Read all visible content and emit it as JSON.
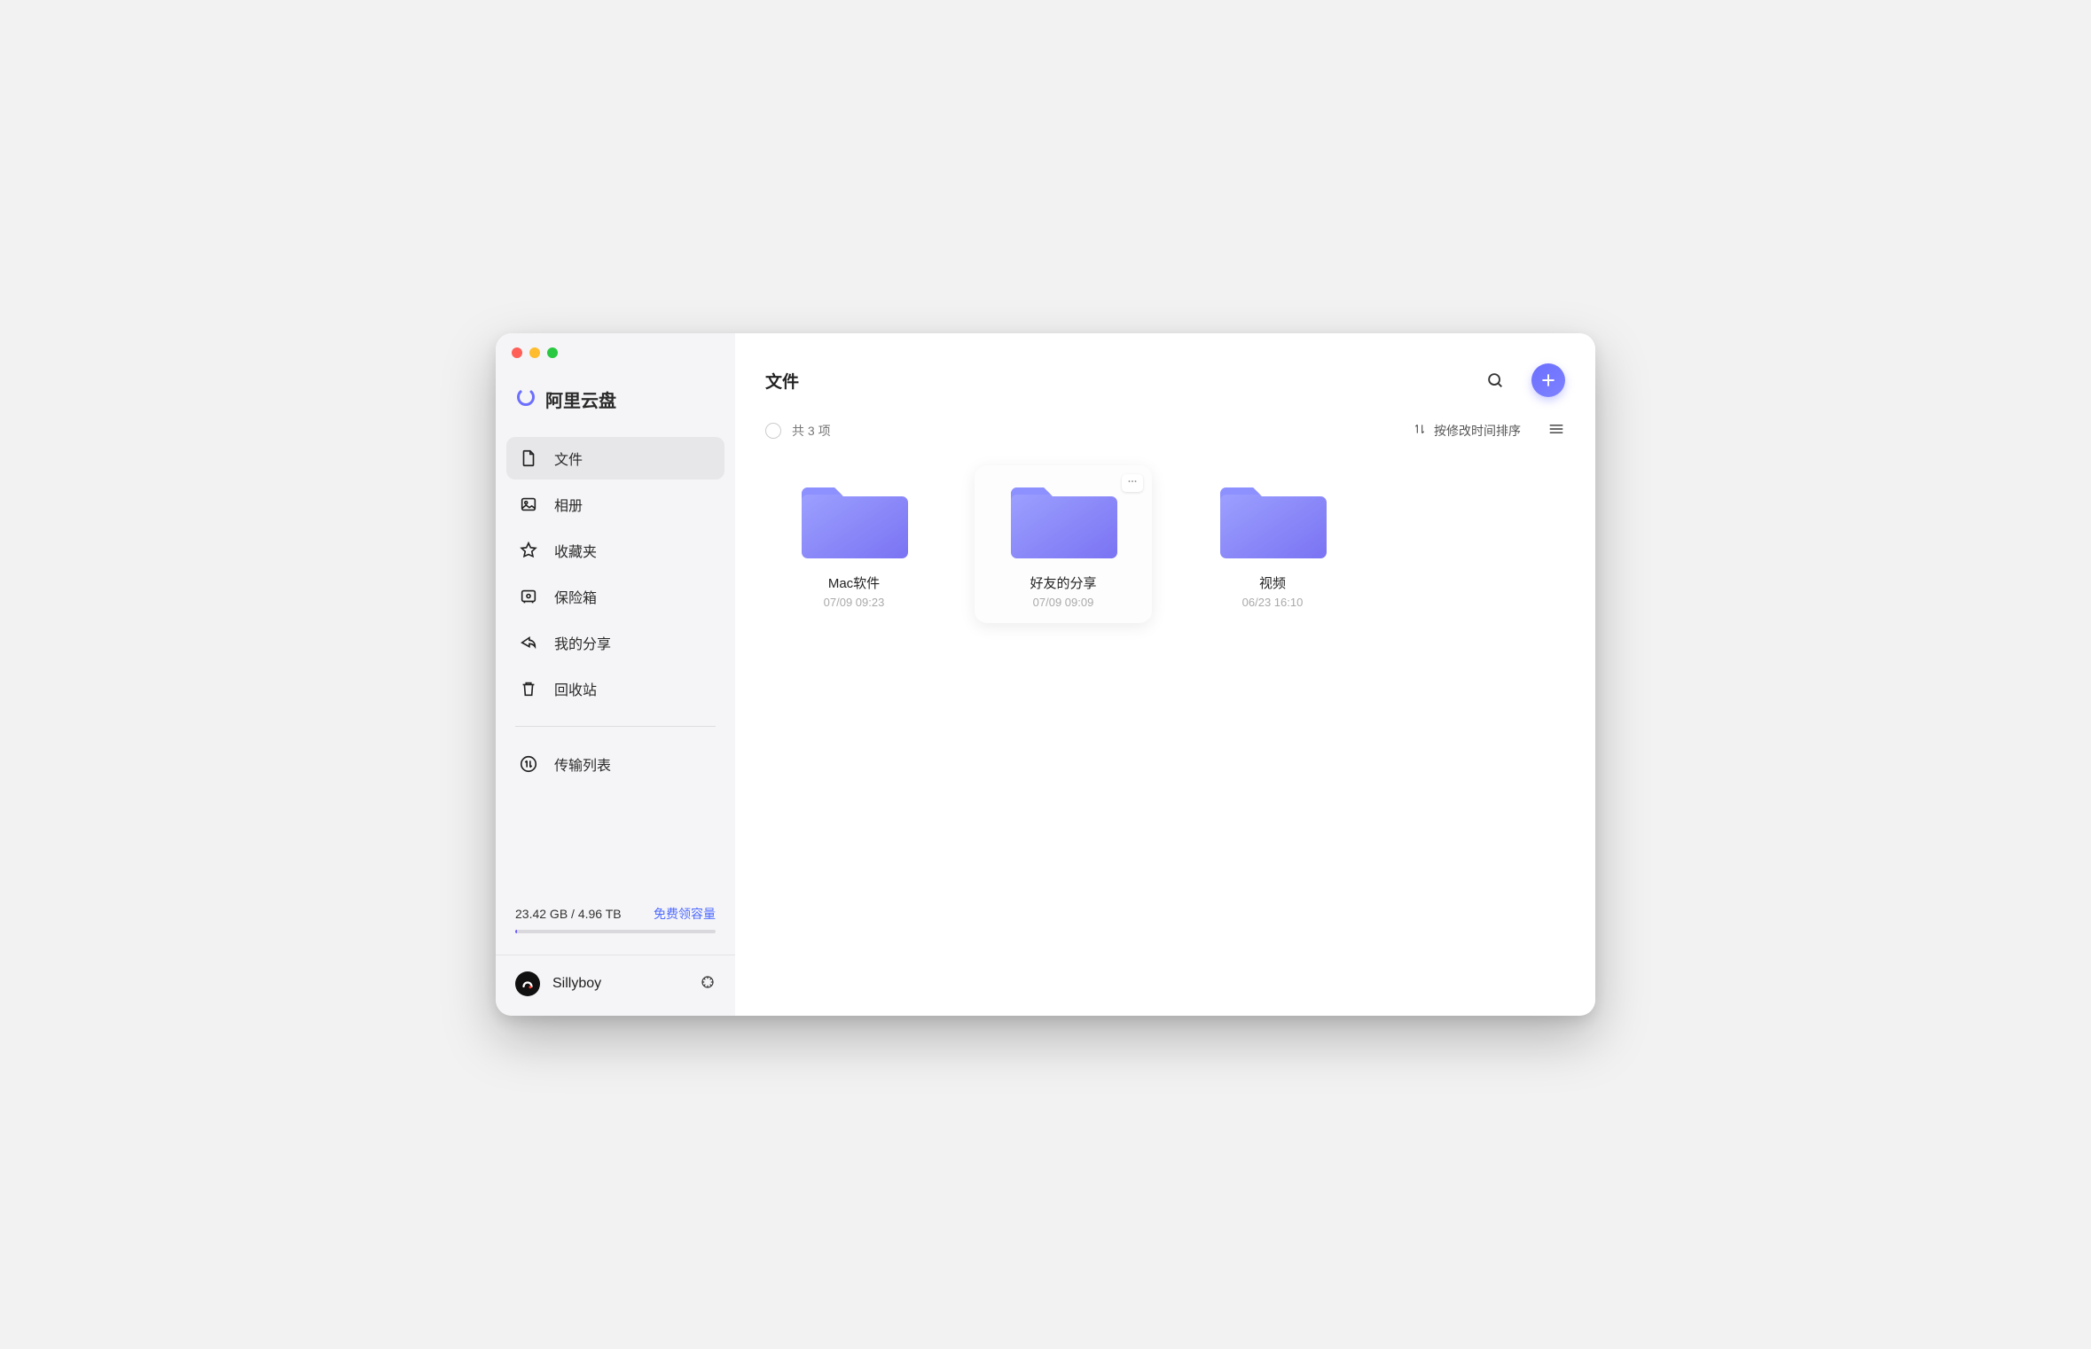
{
  "brand": {
    "name": "阿里云盘"
  },
  "sidebar": {
    "items": [
      {
        "label": "文件",
        "icon": "file-icon",
        "active": true
      },
      {
        "label": "相册",
        "icon": "gallery-icon",
        "active": false
      },
      {
        "label": "收藏夹",
        "icon": "star-icon",
        "active": false
      },
      {
        "label": "保险箱",
        "icon": "vault-icon",
        "active": false
      },
      {
        "label": "我的分享",
        "icon": "share-icon",
        "active": false
      },
      {
        "label": "回收站",
        "icon": "trash-icon",
        "active": false
      }
    ],
    "transfer": {
      "label": "传输列表",
      "icon": "transfer-icon"
    }
  },
  "storage": {
    "usage_text": "23.42 GB / 4.96 TB",
    "link_text": "免费领容量",
    "fill_percent": 1
  },
  "user": {
    "name": "Sillyboy"
  },
  "header": {
    "title": "文件"
  },
  "toolbar": {
    "count_text": "共 3 项",
    "sort_text": "按修改时间排序"
  },
  "files": [
    {
      "name": "Mac软件",
      "date": "07/09 09:23",
      "hovered": false
    },
    {
      "name": "好友的分享",
      "date": "07/09 09:09",
      "hovered": true
    },
    {
      "name": "视频",
      "date": "06/23 16:10",
      "hovered": false
    }
  ],
  "colors": {
    "accent": "#6c6fff"
  }
}
